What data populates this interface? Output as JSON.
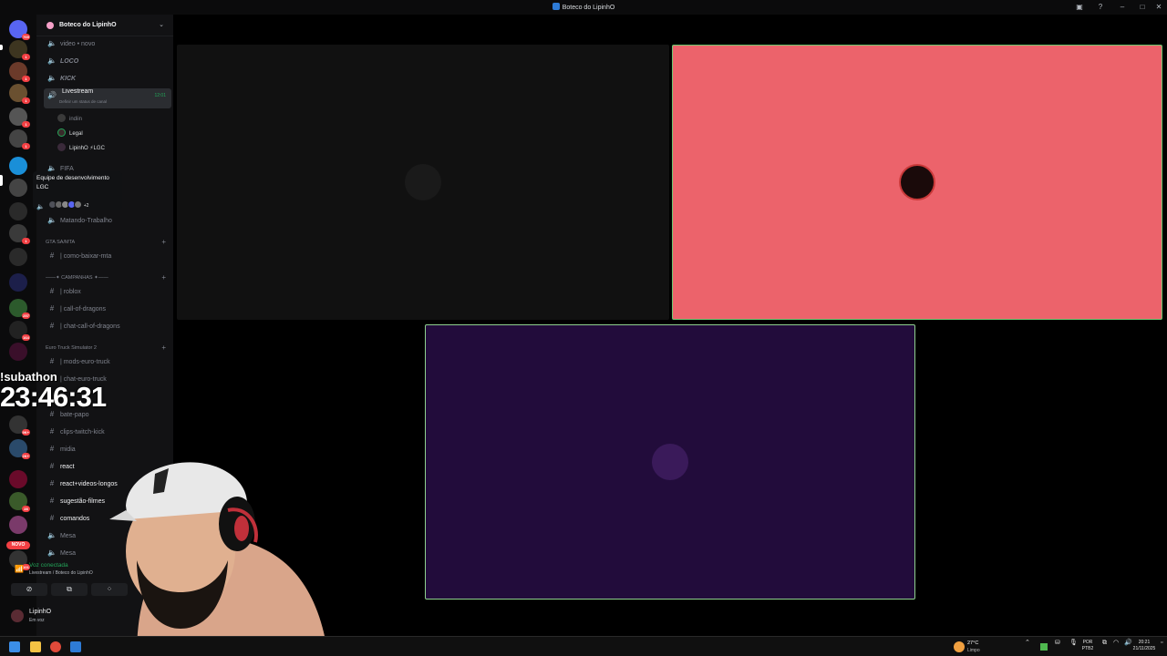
{
  "window": {
    "title": "Boteco do LipinhO",
    "controls": [
      "inbox-icon",
      "help-icon",
      "minimize-icon",
      "maximize-icon",
      "close-icon"
    ]
  },
  "rail": {
    "badges": [
      "769",
      "1",
      "1",
      "1",
      "1",
      "1",
      "1",
      "257",
      "164",
      "9K+",
      "2K+",
      "28",
      "101"
    ],
    "novo_label": "NOVO"
  },
  "sidebar": {
    "guild_name": "Boteco do LipinhO",
    "channels": [
      {
        "label": "video • novo",
        "icon": "speaker-icon"
      },
      {
        "label": "LOCO",
        "icon": "speaker-icon"
      },
      {
        "label": "KICK",
        "icon": "speaker-icon"
      },
      {
        "label": "Livestream",
        "icon": "speaker-icon",
        "time": "12:01",
        "status": "Definir um status de canal"
      },
      {
        "label": "FIFA",
        "icon": "speaker-icon"
      },
      {
        "label": "Matando-Trabalho",
        "icon": "speaker-icon"
      }
    ],
    "voice_users": [
      "indiin",
      "Legal",
      "LipinhO ⚡LGC"
    ],
    "cat_gta": "GTA SA/MTA",
    "ch_gta": "| como-baixar-mta",
    "cat_campanhas": "——✦ CAMPANHAS ✦——",
    "ch_camp": [
      "| roblox",
      "| call-of-dragons",
      "| chat-call-of-dragons"
    ],
    "cat_euro": "Euro Truck Simulator 2",
    "ch_euro": [
      "| mods-euro-truck",
      "| chat-euro-truck"
    ],
    "ch_misc": [
      "bate-papo",
      "clips-twitch-kick",
      "midia",
      "react",
      "react+videos-longos",
      "sugestão-filmes",
      "comandos",
      "Mesa",
      "Mesa"
    ]
  },
  "tooltip": {
    "title": "Equipe de desenvolvimento LGC",
    "more": "+2"
  },
  "overlay": {
    "subathon_label": "!subathon",
    "subathon_timer": "23:46:31"
  },
  "voice_panel": {
    "status": "Voz conectada",
    "location": "Livestream / Boteco do LipinhO"
  },
  "user": {
    "name": "LipinhO",
    "status": "Em voz"
  },
  "stage": {
    "tile_colors": {
      "left": "#111111",
      "right": "#ec636b",
      "bottom": "#220c3b",
      "right_border": "#6ac870",
      "bottom_border": "#8ed08e"
    }
  },
  "taskbar": {
    "weather_temp": "27°C",
    "weather_desc": "Limpo",
    "lang": "POR",
    "layout": "PTB2",
    "time": "20:21",
    "date": "21/11/2025"
  }
}
